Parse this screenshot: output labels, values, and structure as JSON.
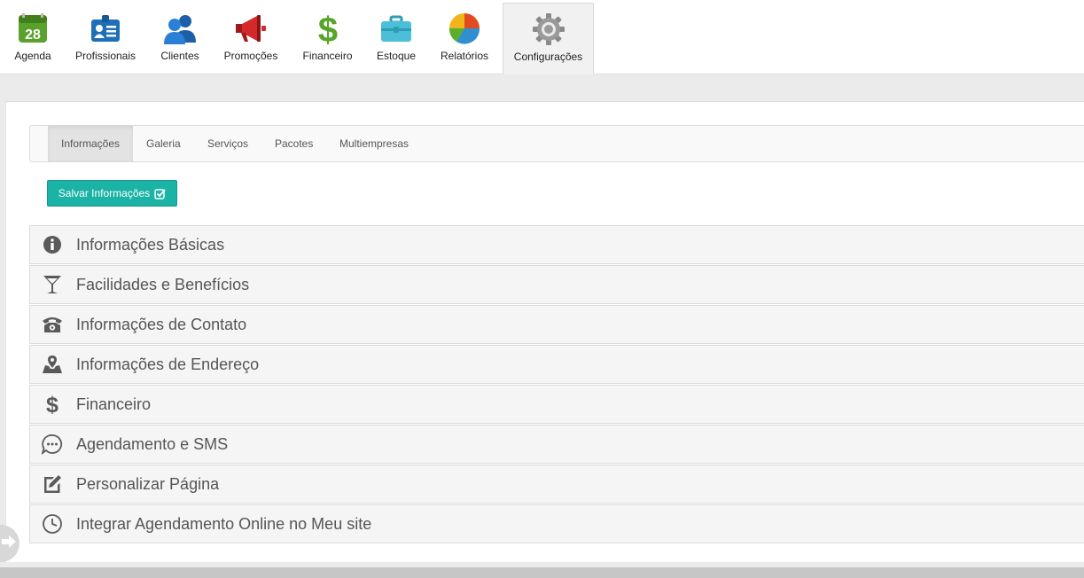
{
  "nav": {
    "items": [
      {
        "label": "Agenda",
        "icon": "calendar-icon",
        "badge": "28"
      },
      {
        "label": "Profissionais",
        "icon": "id-card-icon"
      },
      {
        "label": "Clientes",
        "icon": "users-icon"
      },
      {
        "label": "Promoções",
        "icon": "megaphone-icon"
      },
      {
        "label": "Financeiro",
        "icon": "dollar-icon"
      },
      {
        "label": "Estoque",
        "icon": "briefcase-icon"
      },
      {
        "label": "Relatórios",
        "icon": "pie-chart-icon"
      },
      {
        "label": "Configurações",
        "icon": "gear-icon",
        "active": true
      }
    ]
  },
  "subtabs": [
    {
      "label": "Informações",
      "active": true
    },
    {
      "label": "Galeria"
    },
    {
      "label": "Serviços"
    },
    {
      "label": "Pacotes"
    },
    {
      "label": "Multiempresas"
    }
  ],
  "save_button": {
    "label": "Salvar Informações",
    "icon": "check-square-icon",
    "color": "#1ab3a6"
  },
  "sections": [
    {
      "title": "Informações Básicas",
      "icon": "info-icon"
    },
    {
      "title": "Facilidades e Benefícios",
      "icon": "cocktail-icon"
    },
    {
      "title": "Informações de Contato",
      "icon": "phone-icon"
    },
    {
      "title": "Informações de Endereço",
      "icon": "map-icon"
    },
    {
      "title": "Financeiro",
      "icon": "dollar-icon"
    },
    {
      "title": "Agendamento e SMS",
      "icon": "chat-icon"
    },
    {
      "title": "Personalizar Página",
      "icon": "edit-icon"
    },
    {
      "title": "Integrar Agendamento Online no Meu site",
      "icon": "clock-icon"
    }
  ]
}
